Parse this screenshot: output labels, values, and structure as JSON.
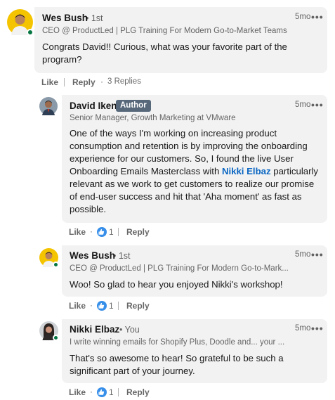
{
  "colors": {
    "bubble": "#f2f2f2",
    "mention": "#0a66c2",
    "online": "#057642",
    "author_badge": "#56687a",
    "like_reaction": "#378fe9"
  },
  "icons": {
    "more": "more-horizontal-icon",
    "like_reaction": "thumbs-up-reaction-icon",
    "presence": "online-status-icon"
  },
  "comment": {
    "name": "Wes Bush",
    "degree": "• 1st",
    "headline": "CEO @ ProductLed | PLG Training For Modern Go-to-Market Teams",
    "time": "5mo",
    "more": "•••",
    "text": "Congrats David!! Curious, what was your favorite part of the program?",
    "actions": {
      "like": "Like",
      "reply": "Reply",
      "replies": "3 Replies"
    }
  },
  "replies": [
    {
      "name": "David Iken",
      "badge": "Author",
      "headline": "Senior Manager, Growth Marketing at VMware",
      "time": "5mo",
      "more": "•••",
      "text_before": "One of the ways I'm working on increasing product consumption and retention is by improving the onboarding experience for our customers. So, I found the live User Onboarding Emails Masterclass with ",
      "mention": "Nikki Elbaz",
      "text_after": " particularly relevant as we work to get customers to realize our promise of end-user success and hit that 'Aha moment' as fast as possible.",
      "like": "Like",
      "like_count": "1",
      "reply": "Reply"
    },
    {
      "name": "Wes Bush",
      "degree": "• 1st",
      "headline": "CEO @ ProductLed | PLG Training For Modern Go-to-Mark...",
      "time": "5mo",
      "more": "•••",
      "text": "Woo! So glad to hear you enjoyed Nikki's workshop!",
      "like": "Like",
      "like_count": "1",
      "reply": "Reply"
    },
    {
      "name": "Nikki Elbaz",
      "degree": "• You",
      "headline": "I write winning emails for Shopify Plus, Doodle and... your ...",
      "time": "5mo",
      "more": "•••",
      "text": "That's so awesome to hear! So grateful to be such a significant part of your journey.",
      "like": "Like",
      "like_count": "1",
      "reply": "Reply"
    }
  ],
  "separator": "·"
}
